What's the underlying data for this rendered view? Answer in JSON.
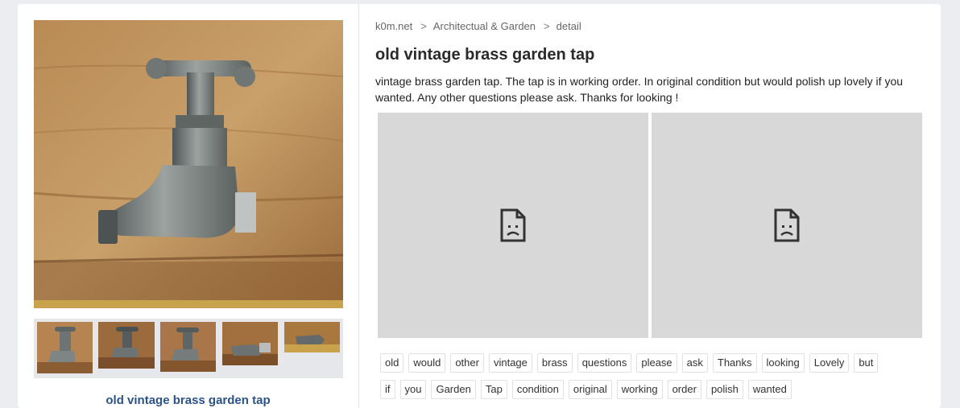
{
  "breadcrumb": [
    {
      "label": "k0m.net"
    },
    {
      "label": "Architectual & Garden"
    },
    {
      "label": "detail"
    }
  ],
  "breadcrumb_separator": ">",
  "product": {
    "title": "old vintage brass garden tap",
    "caption": "old vintage brass garden tap",
    "description": "vintage brass garden tap. The tap is in working order. In original condition but would polish up lovely if you wanted. Any other questions please ask. Thanks for looking !"
  },
  "thumbnails_count": 5,
  "tags_row1": [
    "old",
    "would",
    "other",
    "vintage",
    "brass",
    "questions",
    "please",
    "ask",
    "Thanks",
    "looking",
    "Lovely",
    "but"
  ],
  "tags_row2": [
    "if",
    "you",
    "Garden",
    "Tap",
    "condition",
    "original",
    "working",
    "order",
    "polish",
    "wanted"
  ],
  "colors": {
    "title_link": "#2b5287",
    "frame_bg": "#d8d8d8",
    "page_bg": "#ecedf1"
  },
  "icons": {
    "broken_frame": "sad-document-icon"
  }
}
